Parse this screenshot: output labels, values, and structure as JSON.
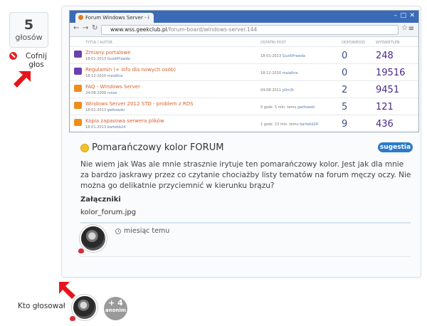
{
  "vote": {
    "count": "5",
    "label": "głosów",
    "cancel_label": "Cofnij głos"
  },
  "browser": {
    "tab_title": "Forum Windows Server - i",
    "url_host": "www.wss.geekclub.pl",
    "url_path": "/forum-board/windows-server.144",
    "columns": [
      "TYTUŁ I AUTOR",
      "OSTATNI POST",
      "ODPOWIEDZI",
      "WYŚWIETLEŃ"
    ],
    "rows": [
      {
        "title": "Zmiany portalowe",
        "meta_date": "18-01-2013",
        "meta_user": "GuzikPrawda",
        "last_date": "18-01-2013",
        "last_user": "GuzikPrawda",
        "replies": "0",
        "views": "248",
        "icon": "purple"
      },
      {
        "title": "Regulamin (+ info dla nowych osób)",
        "meta_date": "18-12-2010",
        "meta_user": "maialkra",
        "last_date": "18-12-2010",
        "last_user": "maialkra",
        "replies": "0",
        "views": "19516",
        "icon": "purple"
      },
      {
        "title": "FAQ - Windows Server",
        "meta_date": "24-08-2009",
        "meta_user": "rvose",
        "last_date": "04-08-2011",
        "last_user": "p0m3t",
        "replies": "2",
        "views": "9451",
        "icon": "orange"
      },
      {
        "title": "Windows Server 2012 STD - problem z RDS",
        "meta_date": "18-01-2013",
        "meta_user": "gwitowski",
        "last_date": "0 godz. 5 min. temu",
        "last_user": "gwitowski",
        "replies": "5",
        "views": "121",
        "icon": "orange"
      },
      {
        "title": "Kopia zapasowa serwera plików",
        "meta_date": "18-01-2013",
        "meta_user": "bartekb24",
        "last_date": "1 godz. 13 min. temu",
        "last_user": "bartekb24",
        "replies": "9",
        "views": "436",
        "icon": "orange"
      }
    ]
  },
  "suggestion": {
    "title": "Pomarańczowy kolor FORUM",
    "badge": "sugestia",
    "body": "Nie wiem jak Was ale mnie strasznie irytuje ten pomarańczowy kolor. Jest jak dla mnie za bardzo jaskrawy przez co czytanie chociażby listy tematów na forum męczy oczy. Nie można go delikatnie przyciemnić w kierunku brązu?",
    "attachments_heading": "Załączniki",
    "attachment_file": "kolor_forum.jpg",
    "posted_time": "miesiąc temu"
  },
  "voters": {
    "label": "Kto głosował",
    "anon_count": "+ 4",
    "anon_label": "anonim"
  },
  "colors": {
    "accent_blue": "#2b7bc9",
    "arrow_red": "#e8141b",
    "forum_orange": "#f08c1c"
  }
}
